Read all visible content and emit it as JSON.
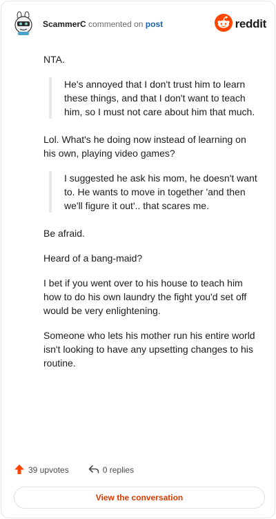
{
  "header": {
    "author": "ScammerC",
    "verb": "commented on",
    "post_link": "post",
    "logo_text": "reddit"
  },
  "comment": {
    "paragraphs_before_q1": [
      "NTA."
    ],
    "quote1": "He's annoyed that I don't trust him to learn these things, and that I don't want to teach him, so I must not care about him that much.",
    "paragraphs_before_q2": [
      "Lol. What's he doing now instead of learning on his own, playing video games?"
    ],
    "quote2": "I suggested he ask his mom, he doesn't want to. He wants to move in together 'and then we'll figure it out'.. that scares me.",
    "paragraphs_after": [
      "Be afraid.",
      "Heard of a bang-maid?",
      "I bet if you went over to his house to teach him how to do his own laundry the fight you'd set off would be very enlightening.",
      "Someone who lets his mother run his entire world isn't looking to have any upsetting changes to his routine."
    ]
  },
  "footer": {
    "upvotes": "39 upvotes",
    "replies": "0 replies",
    "view_conversation": "View the conversation"
  },
  "colors": {
    "reddit_orange": "#ff4500",
    "link_blue": "#1a5fb4",
    "button_text": "#d93a00"
  },
  "icons": [
    "snoo-avatar-icon",
    "reddit-logo-icon",
    "upvote-arrow-icon",
    "reply-arrow-icon"
  ]
}
